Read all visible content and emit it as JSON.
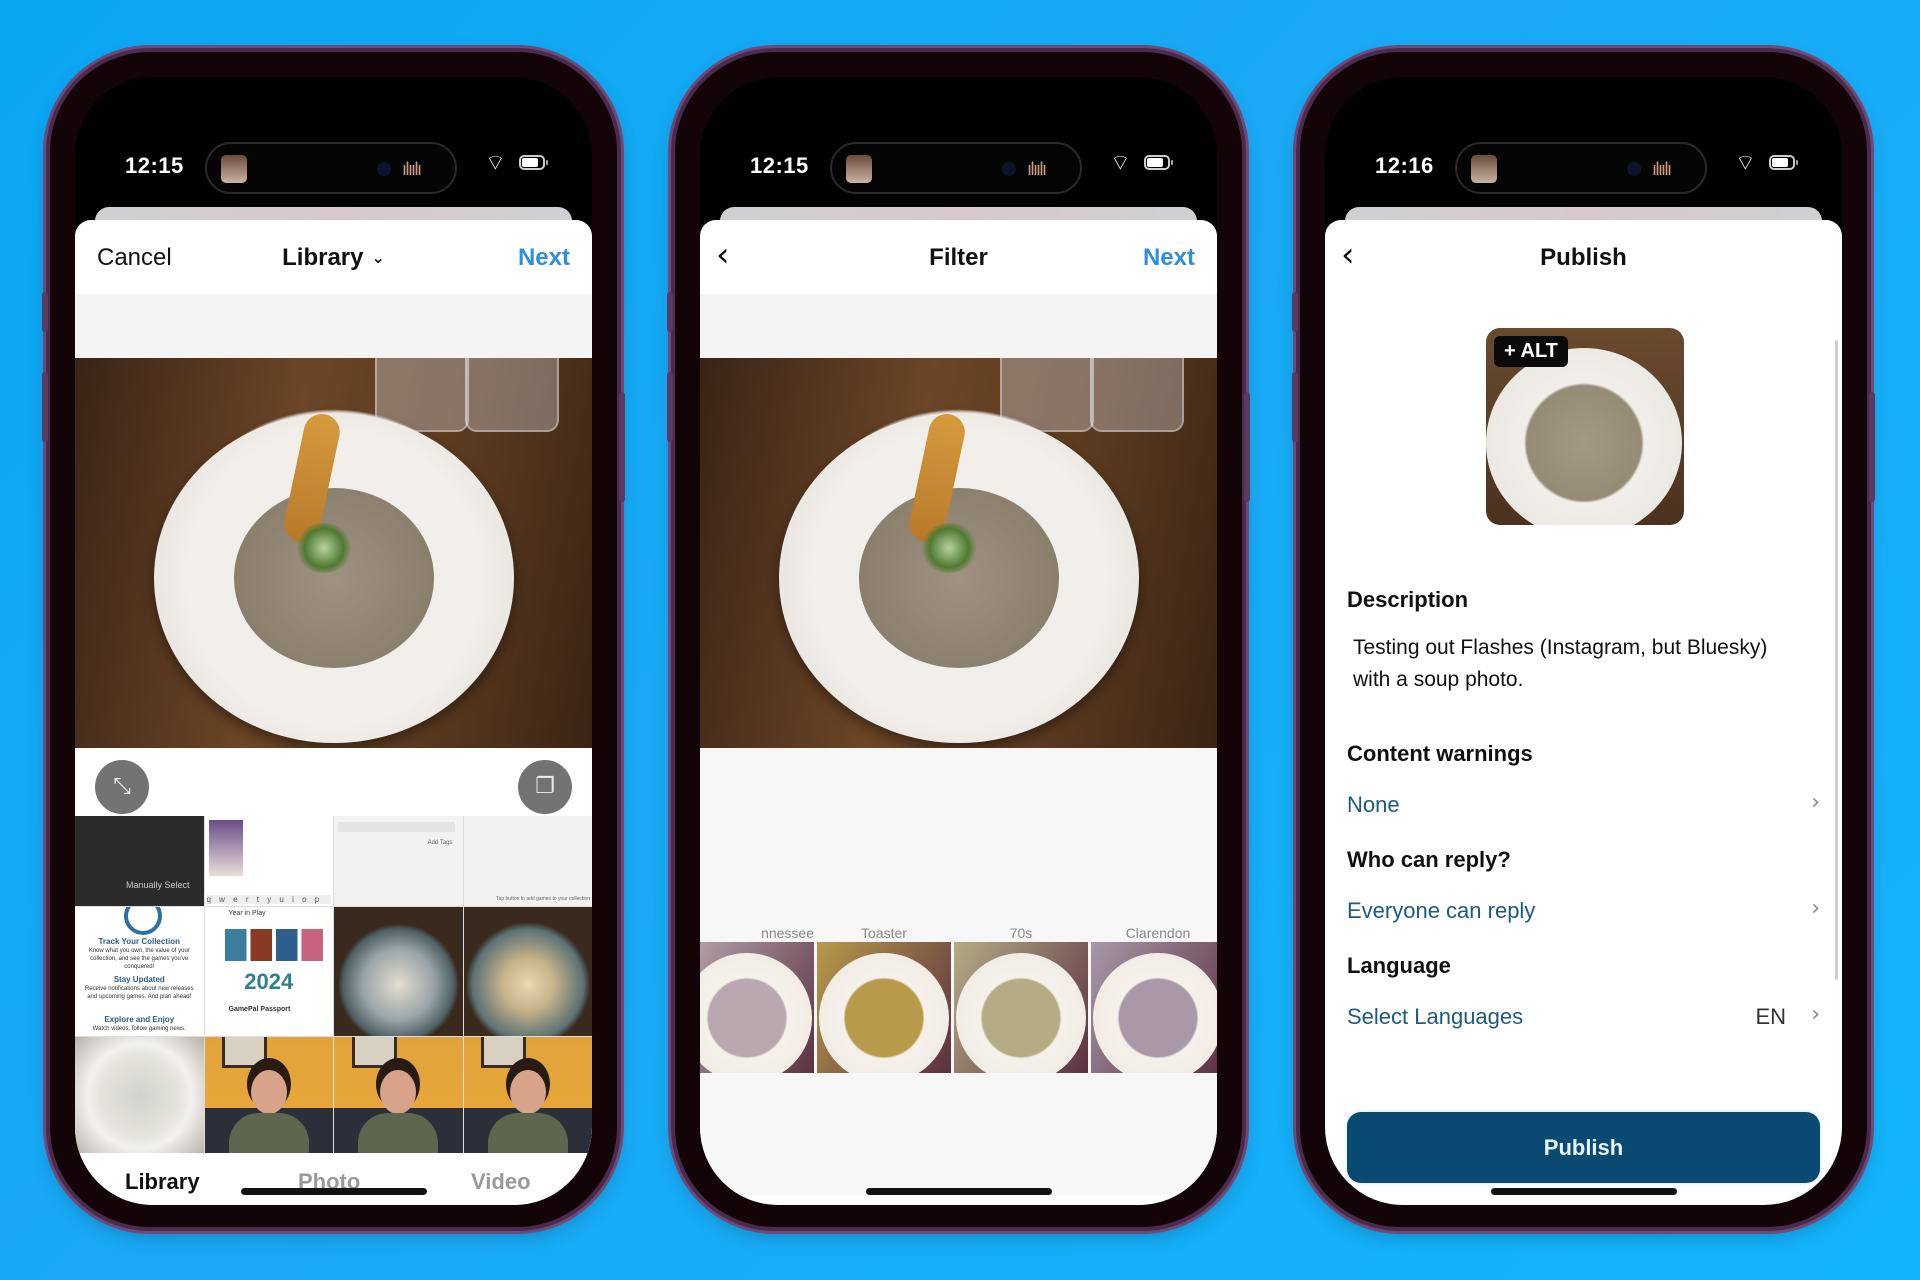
{
  "phones": [
    {
      "status": {
        "time": "12:15"
      },
      "nav": {
        "left": "Cancel",
        "title": "Library",
        "right": "Next"
      },
      "grid": {
        "manually_select": "Manually Select",
        "keyboard_keys": "q w e r t y u i o p",
        "add_tags": "Add Tags",
        "tag_hint": "Tap button to add games to your collection",
        "track_title": "Track Your Collection",
        "track_body": "Know what you own, the value of your collection, and see the games you've conquered!",
        "stay_title": "Stay Updated",
        "stay_body": "Receive notifications about new releases and upcoming games. And plan ahead!",
        "explore_title": "Explore and Enjoy",
        "explore_body": "Watch videos, follow gaming news.",
        "year_label": "2024",
        "year_in_play": "Year in Play",
        "passport_title": "GamePal Passport"
      },
      "tabs": [
        {
          "label": "Library",
          "active": true
        },
        {
          "label": "Photo",
          "active": false
        },
        {
          "label": "Video",
          "active": false
        }
      ]
    },
    {
      "status": {
        "time": "12:15"
      },
      "nav": {
        "title": "Filter",
        "right": "Next"
      },
      "filters": [
        {
          "label": "nnessee",
          "soup": "#b9a8b0"
        },
        {
          "label": "Toaster",
          "soup": "#b79a4a"
        },
        {
          "label": "70s",
          "soup": "#b5ac86"
        },
        {
          "label": "Clarendon",
          "soup": "#a898a8"
        }
      ]
    },
    {
      "status": {
        "time": "12:16"
      },
      "nav": {
        "title": "Publish"
      },
      "alt_badge": "+ ALT",
      "description_heading": "Description",
      "description_text": "Testing out Flashes (Instagram, but Bluesky) with a soup photo.",
      "content_warnings_heading": "Content warnings",
      "content_warnings_value": "None",
      "reply_heading": "Who can reply?",
      "reply_value": "Everyone can reply",
      "language_heading": "Language",
      "language_value": "Select Languages",
      "language_code": "EN",
      "publish_label": "Publish"
    }
  ],
  "colors": {
    "accent": "#2f8fdc",
    "publish_button": "#0a4a72",
    "row_value": "#1d5a80",
    "background": "#12b0f7"
  }
}
